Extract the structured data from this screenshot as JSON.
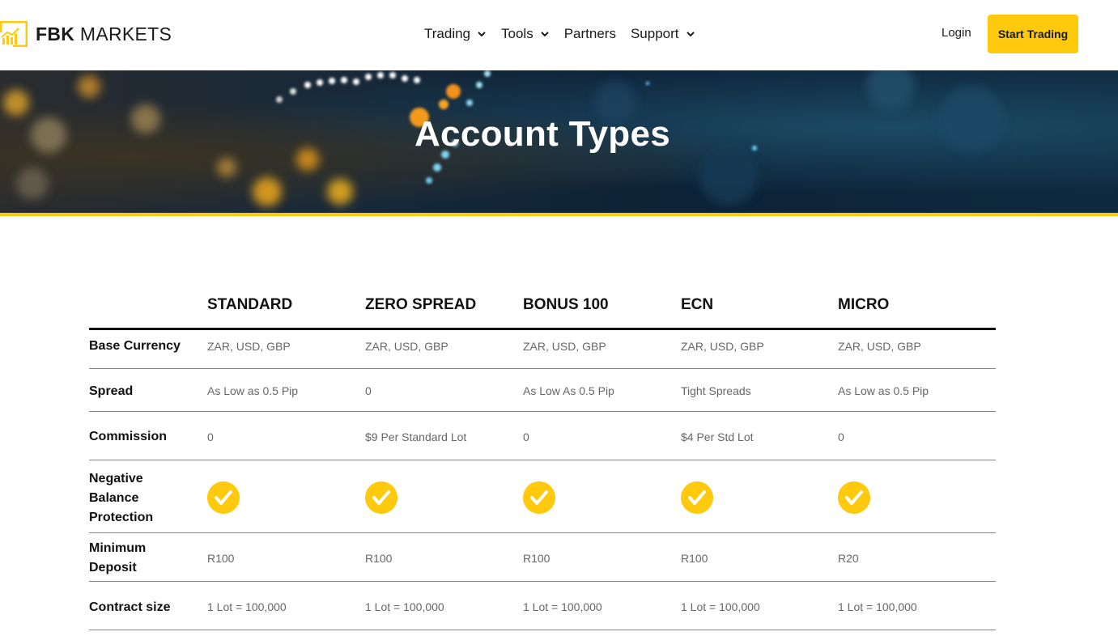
{
  "header": {
    "logo_bold": "FBK",
    "logo_light": " MARKETS",
    "nav": [
      {
        "label": "Trading",
        "icon": "chevron-down-icon"
      },
      {
        "label": "Tools",
        "icon": "chevron-down-icon"
      },
      {
        "label": "Partners"
      },
      {
        "label": "Support",
        "icon": "chevron-down-icon"
      }
    ],
    "login_label": "Login",
    "cta_label": "Start Trading"
  },
  "hero": {
    "title": "Account Types"
  },
  "colors": {
    "accent": "#ffc90e",
    "text": "#111111",
    "muted": "#666666"
  },
  "table": {
    "columns": [
      "STANDARD",
      "ZERO SPREAD",
      "BONUS 100",
      "ECN",
      "MICRO"
    ],
    "rows": [
      {
        "label": "Base Currency",
        "values": [
          "ZAR, USD, GBP",
          "ZAR, USD, GBP",
          "ZAR, USD, GBP",
          "ZAR, USD, GBP",
          "ZAR, USD, GBP"
        ]
      },
      {
        "label": "Spread",
        "values": [
          "As Low as 0.5 Pip",
          "0",
          "As Low As 0.5 Pip",
          "Tight Spreads",
          "As Low as 0.5 Pip"
        ]
      },
      {
        "label": "Commission",
        "values": [
          "0",
          "$9 Per Standard Lot",
          "0",
          "$4 Per Std Lot",
          "0"
        ]
      },
      {
        "label_lines": [
          "Negative",
          "Balance",
          "Protection"
        ],
        "icon": "check-circle-icon",
        "values": [
          true,
          true,
          true,
          true,
          true
        ]
      },
      {
        "label_lines": [
          "Minimum",
          "Deposit"
        ],
        "values": [
          "R100",
          "R100",
          "R100",
          "R100",
          "R20"
        ]
      },
      {
        "label": "Contract size",
        "values": [
          "1 Lot = 100,000",
          "1 Lot = 100,000",
          "1 Lot = 100,000",
          "1 Lot = 100,000",
          "1 Lot = 100,000"
        ]
      }
    ]
  }
}
